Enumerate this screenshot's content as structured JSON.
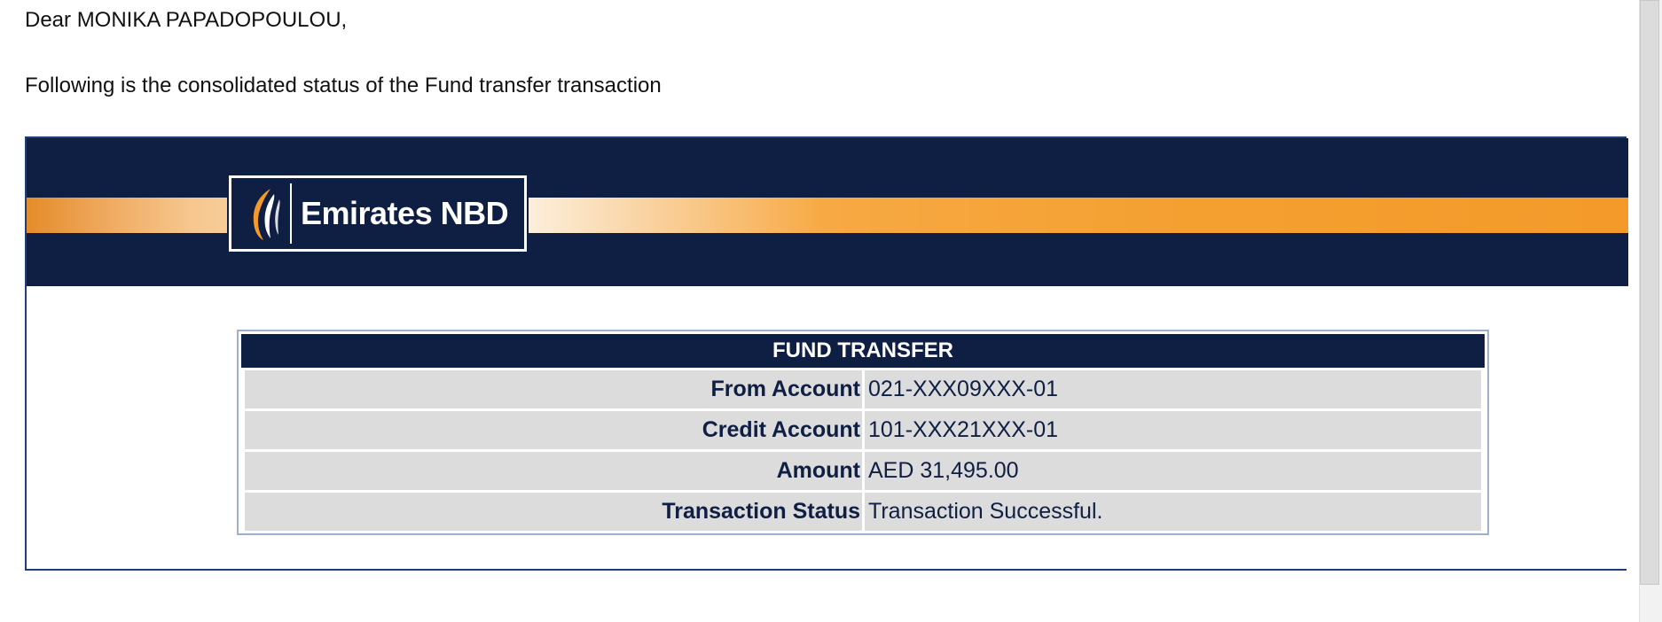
{
  "email": {
    "greeting": "Dear MONIKA PAPADOPOULOU,",
    "intro": "Following is the consolidated status of the Fund transfer transaction"
  },
  "banner": {
    "logo_text": "Emirates NBD",
    "colors": {
      "navy": "#0f1e43",
      "orange": "#f39a2a"
    }
  },
  "fund_transfer": {
    "title": "FUND TRANSFER",
    "rows": [
      {
        "label": "From Account",
        "value": "021-XXX09XXX-01"
      },
      {
        "label": "Credit Account",
        "value": "101-XXX21XXX-01"
      },
      {
        "label": "Amount",
        "value": "AED 31,495.00"
      },
      {
        "label": "Transaction Status",
        "value": "Transaction Successful."
      }
    ]
  }
}
